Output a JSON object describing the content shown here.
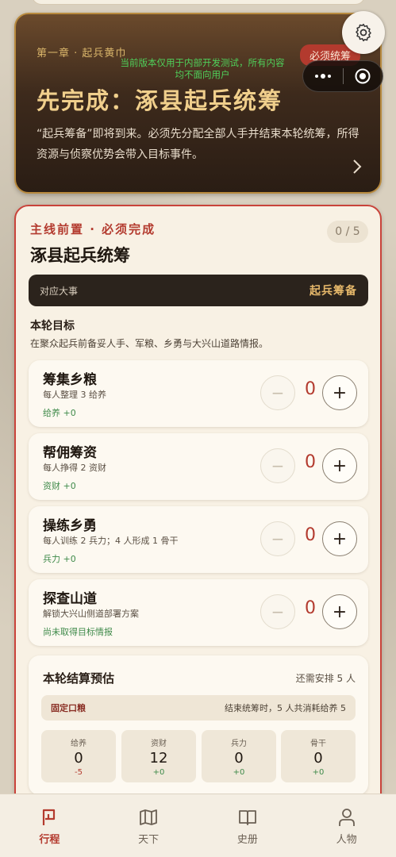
{
  "hero": {
    "chapter": "第一章 · 起兵黄巾",
    "dev_note": "当前版本仅用于内部开发测试，所有内容均不面向用户",
    "badge": "必须统筹",
    "title": "先完成：涿县起兵统筹",
    "description": "“起兵筹备”即将到来。必须先分配全部人手并结束本轮统筹，所得资源与侦察优势会带入目标事件。"
  },
  "mission": {
    "label": "主线前置 · 必须完成",
    "progress": "0 / 5",
    "title": "涿县起兵统筹",
    "event_label": "对应大事",
    "event_value": "起兵筹备",
    "goal_title": "本轮目标",
    "goal_desc": "在聚众起兵前备妥人手、军粮、乡勇与大兴山道路情报。"
  },
  "tasks": [
    {
      "name": "筹集乡粮",
      "sub": "每人整理 3 给养",
      "effect": "给养 +0",
      "qty": "0"
    },
    {
      "name": "帮佣筹资",
      "sub": "每人挣得 2 资财",
      "effect": "资财 +0",
      "qty": "0"
    },
    {
      "name": "操练乡勇",
      "sub": "每人训练 2 兵力；4 人形成 1 骨干",
      "effect": "兵力 +0",
      "qty": "0"
    },
    {
      "name": "探查山道",
      "sub": "解锁大兴山侧道部署方案",
      "effect": "尚未取得目标情报",
      "qty": "0"
    }
  ],
  "controls": {
    "minus": "−",
    "plus": "+"
  },
  "estimate": {
    "title": "本轮结算预估",
    "remaining": "还需安排 5 人",
    "ration_label": "固定口粮",
    "ration_value": "结束统筹时，5 人共消耗给养 5",
    "stats": [
      {
        "name": "给养",
        "value": "0",
        "delta": "-5",
        "sign": "neg"
      },
      {
        "name": "资财",
        "value": "12",
        "delta": "+0",
        "sign": "pos"
      },
      {
        "name": "兵力",
        "value": "0",
        "delta": "+0",
        "sign": "pos"
      },
      {
        "name": "骨干",
        "value": "0",
        "delta": "+0",
        "sign": "pos"
      }
    ]
  },
  "tabbar": [
    {
      "label": "行程",
      "icon": "flag-icon",
      "active": true
    },
    {
      "label": "天下",
      "icon": "map-icon",
      "active": false
    },
    {
      "label": "史册",
      "icon": "book-icon",
      "active": false
    },
    {
      "label": "人物",
      "icon": "person-icon",
      "active": false
    }
  ],
  "colors": {
    "accent": "#b33a2e",
    "gold": "#f0cf8c",
    "positive": "#3f8a4a"
  }
}
